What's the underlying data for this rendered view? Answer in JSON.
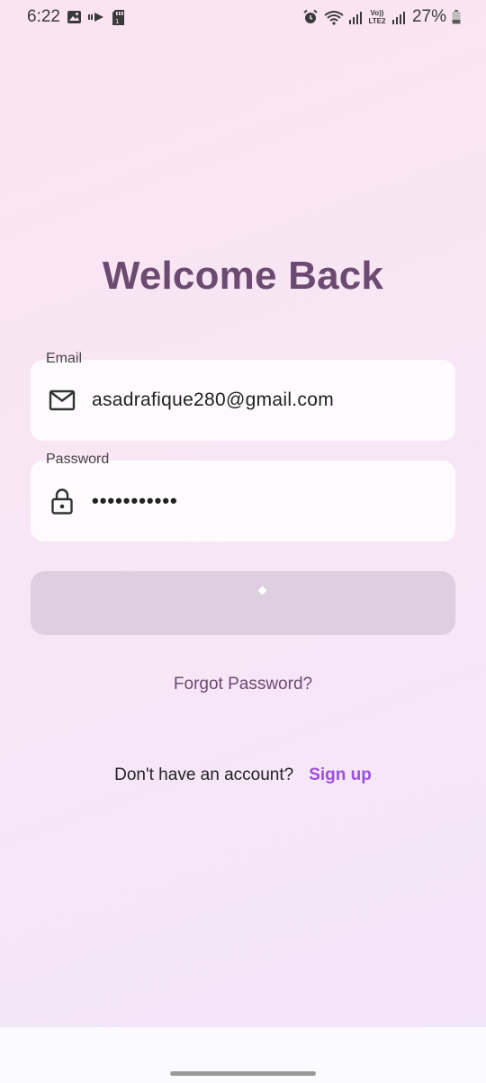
{
  "status_bar": {
    "time": "6:22",
    "battery": "27%",
    "network_label": "Vo)) LTE2",
    "icons_left": [
      "image-icon",
      "cast-icon",
      "sd-card-icon"
    ],
    "icons_right": [
      "alarm-icon",
      "wifi-icon",
      "signal-icon",
      "volte-icon",
      "signal-icon",
      "battery-icon"
    ]
  },
  "login": {
    "title": "Welcome Back",
    "email": {
      "label": "Email",
      "value": "asadrafique280@gmail.com",
      "icon": "mail-icon"
    },
    "password": {
      "label": "Password",
      "value": "•••••••••••",
      "icon": "lock-icon"
    },
    "submit_state": "loading",
    "forgot_label": "Forgot Password?",
    "signup_prompt": "Don't have an account?",
    "signup_link": "Sign up"
  },
  "colors": {
    "title": "#6c4a72",
    "accent_link": "#9b4fe0",
    "button_disabled": "#ddcfe0",
    "field_bg": "#fdfbfd"
  }
}
